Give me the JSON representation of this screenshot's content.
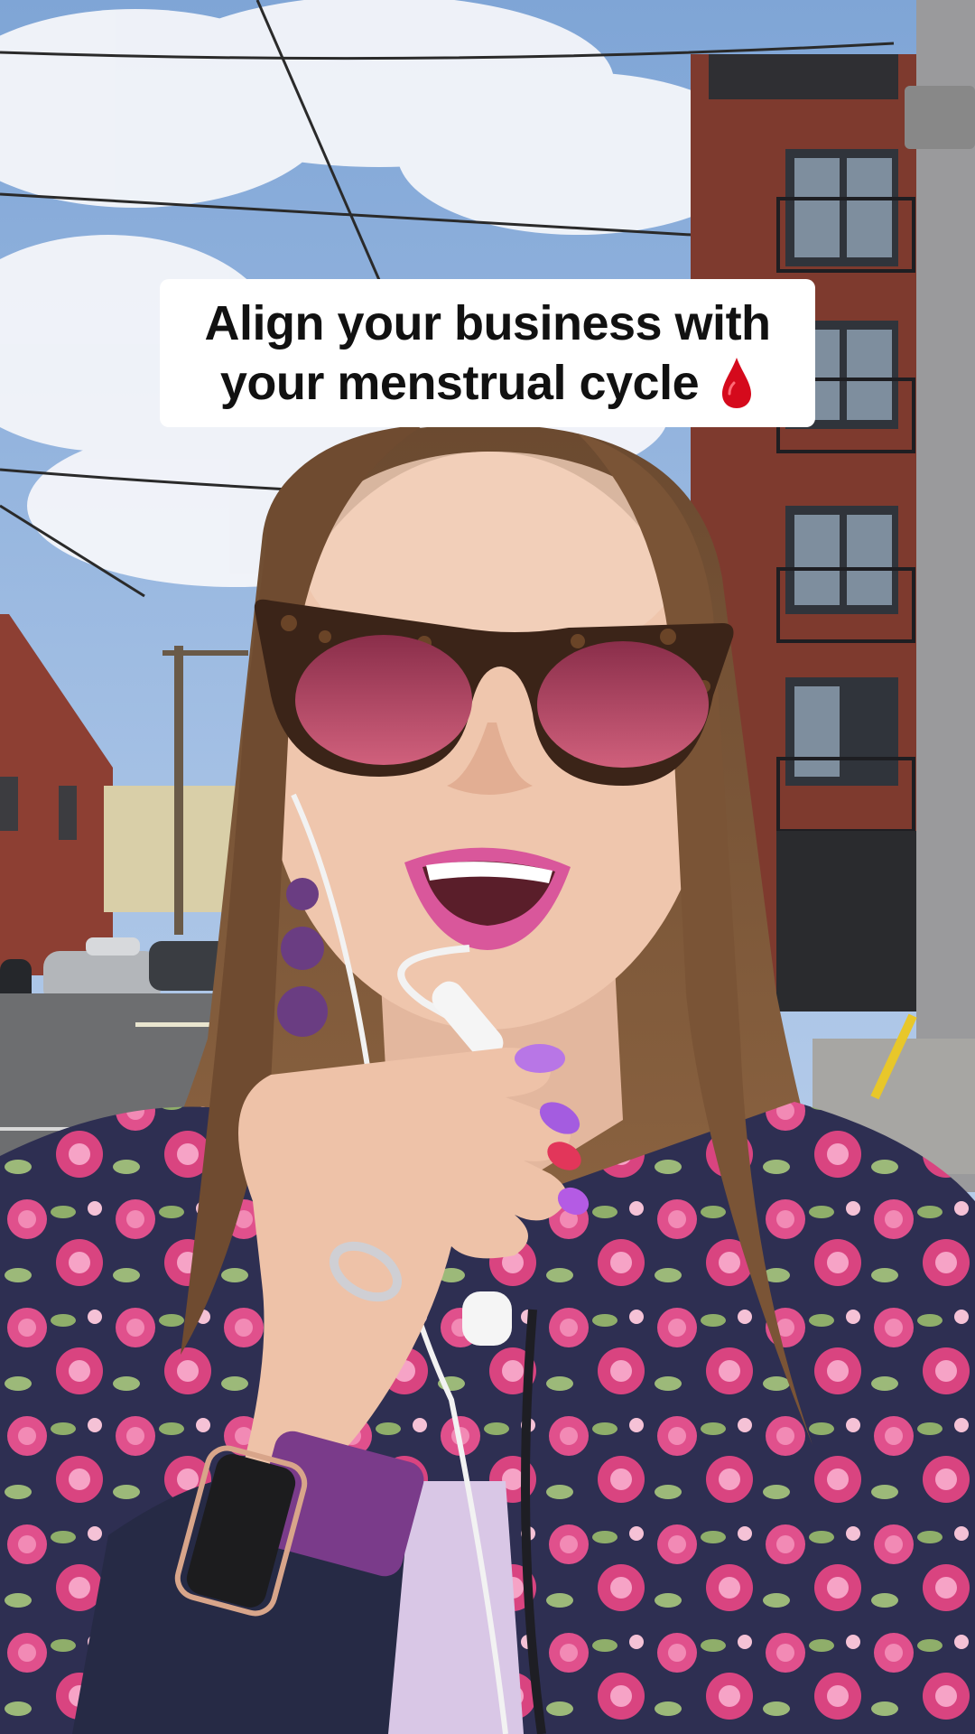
{
  "caption": {
    "line1": "Align your business with",
    "line2": "your menstrual cycle",
    "emoji_icon": "blood-drop-icon",
    "emoji_color": "#d50a1c"
  },
  "scene": {
    "description_colors": {
      "sky": "#9dbce4",
      "building_brick": "#8a3b2e",
      "hair": "#7a5233",
      "lens": "#b24a68",
      "jacket": "#2f2f4e",
      "flowers": "#e24d8b"
    }
  }
}
